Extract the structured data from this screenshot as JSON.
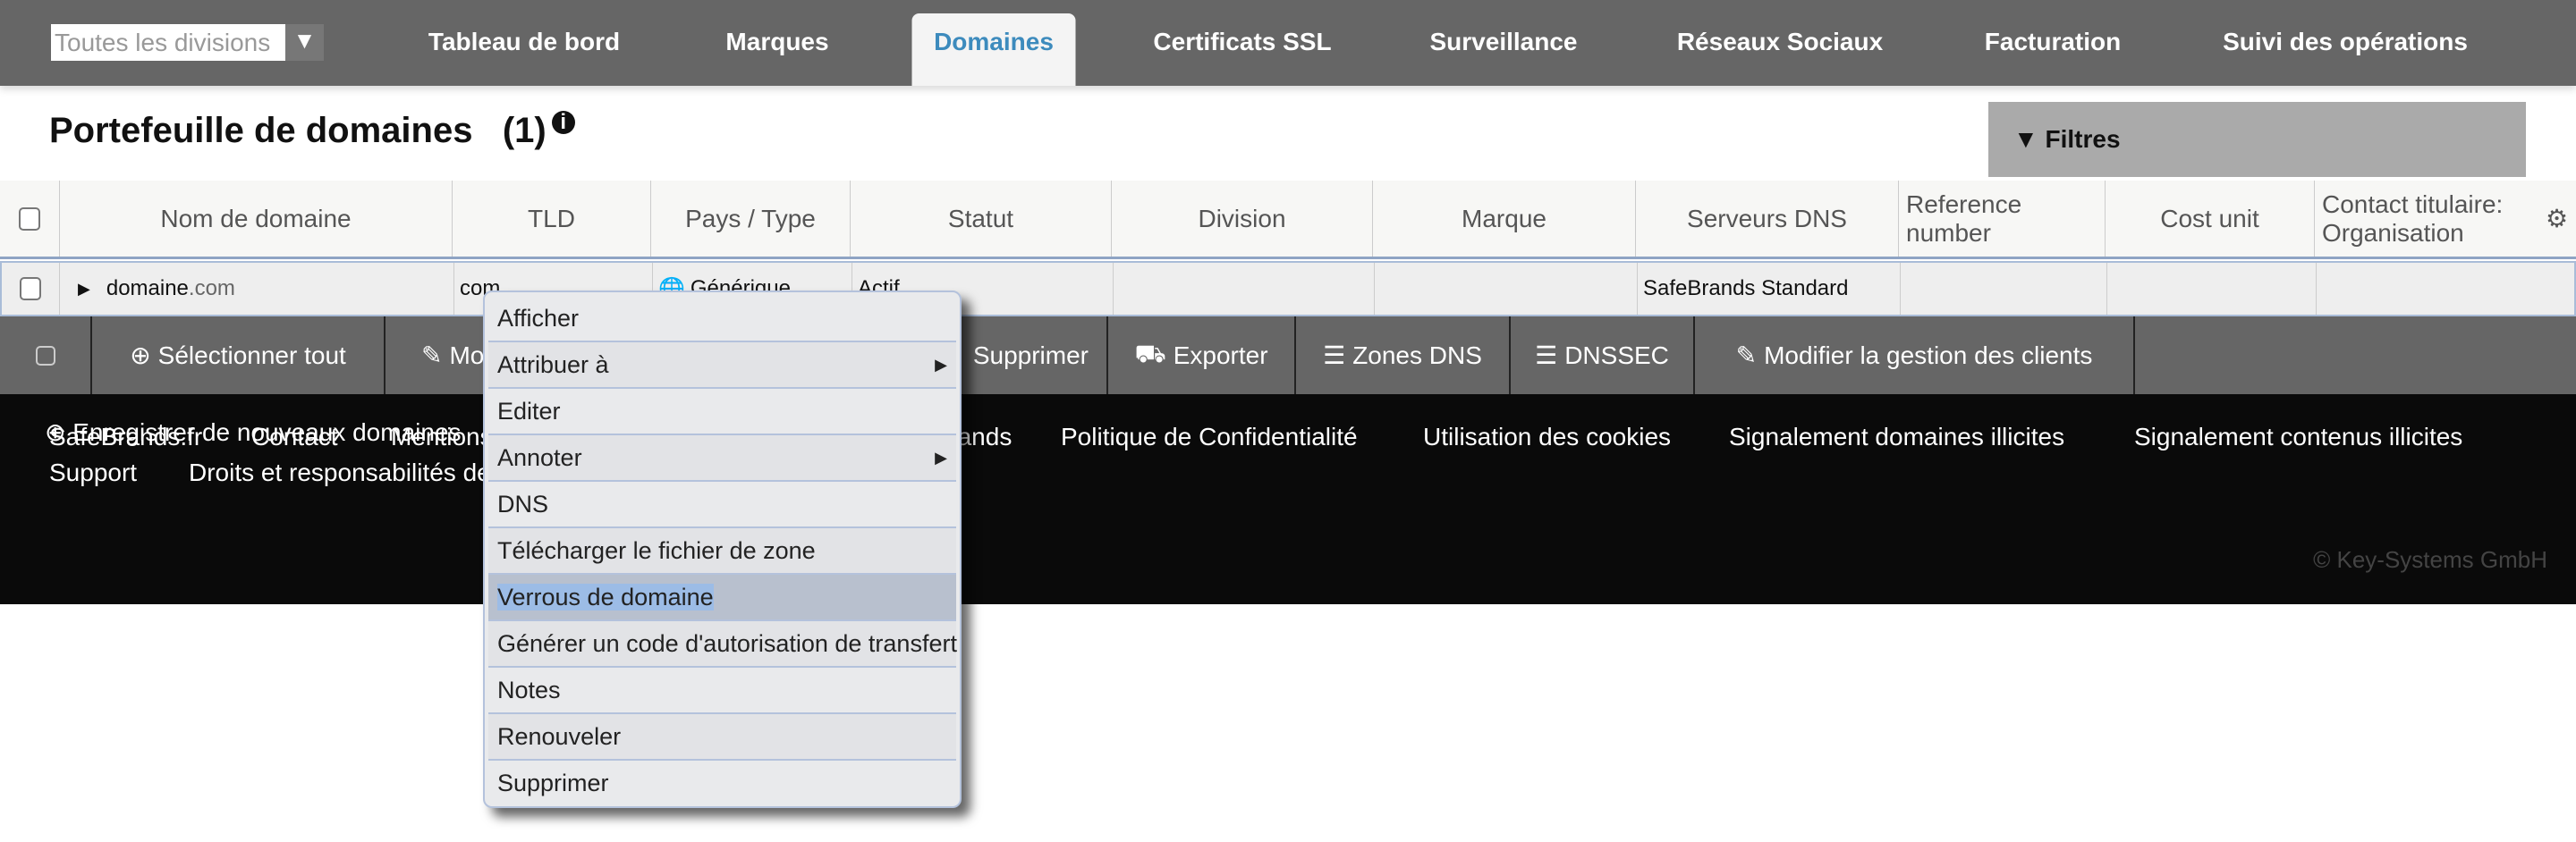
{
  "nav": {
    "division_select": "Toutes les divisions",
    "tabs": [
      {
        "label": "Tableau de bord"
      },
      {
        "label": "Marques"
      },
      {
        "label": "Domaines",
        "active": true
      },
      {
        "label": "Certificats SSL"
      },
      {
        "label": "Surveillance"
      },
      {
        "label": "Réseaux Sociaux"
      },
      {
        "label": "Facturation"
      },
      {
        "label": "Suivi des opérations"
      }
    ]
  },
  "page": {
    "title": "Portefeuille de domaines",
    "count": "(1)",
    "filters_label": "Filtres"
  },
  "table": {
    "columns": [
      "Nom de domaine",
      "TLD",
      "Pays / Type",
      "Statut",
      "Division",
      "Marque",
      "Serveurs DNS",
      "Reference number",
      "Cost unit",
      "Contact titulaire: Organisation"
    ],
    "rows": [
      {
        "name": "domaine",
        "ext": ".com",
        "tld": "com",
        "type": "Générique",
        "status": "Actif",
        "division": "",
        "brand": "",
        "dns": "SafeBrands Standard",
        "ref": "",
        "cost": "",
        "org": ""
      }
    ]
  },
  "actions": {
    "select_all": "Sélectionner tout",
    "modify": "Modifier",
    "delete": "Supprimer",
    "export": "Exporter",
    "dns_zones": "Zones DNS",
    "dnssec": "DNSSEC",
    "client_mgmt": "Modifier la gestion des clients"
  },
  "footer": {
    "register": "Enregistrer de nouveaux domaines",
    "links_row1": [
      "SafeBrands.fr",
      "Contact",
      "Mentions légales",
      "SafeBrands",
      "Politique de Confidentialité",
      "Utilisation des cookies",
      "Signalement domaines illicites",
      "Signalement contenus illicites"
    ],
    "links_row2": [
      "Support",
      "Droits et responsabilités des titulaires"
    ],
    "copyright": "© Key-Systems GmbH"
  },
  "context_menu": {
    "items": [
      {
        "label": "Afficher"
      },
      {
        "label": "Attribuer à",
        "submenu": true
      },
      {
        "label": "Editer"
      },
      {
        "label": "Annoter",
        "submenu": true
      },
      {
        "label": "DNS"
      },
      {
        "label": "Télécharger le fichier de zone"
      },
      {
        "label": "Verrous de domaine",
        "highlighted": true
      },
      {
        "label": "Générer un code d'autorisation de transfert"
      },
      {
        "label": "Notes"
      },
      {
        "label": "Renouveler"
      },
      {
        "label": "Supprimer"
      }
    ]
  },
  "colors": {
    "nav_bg": "#666666",
    "active_tab": "#3d8bbd",
    "footer_bg": "#0a0a0a",
    "menu_highlight": "#b8c0ce"
  }
}
